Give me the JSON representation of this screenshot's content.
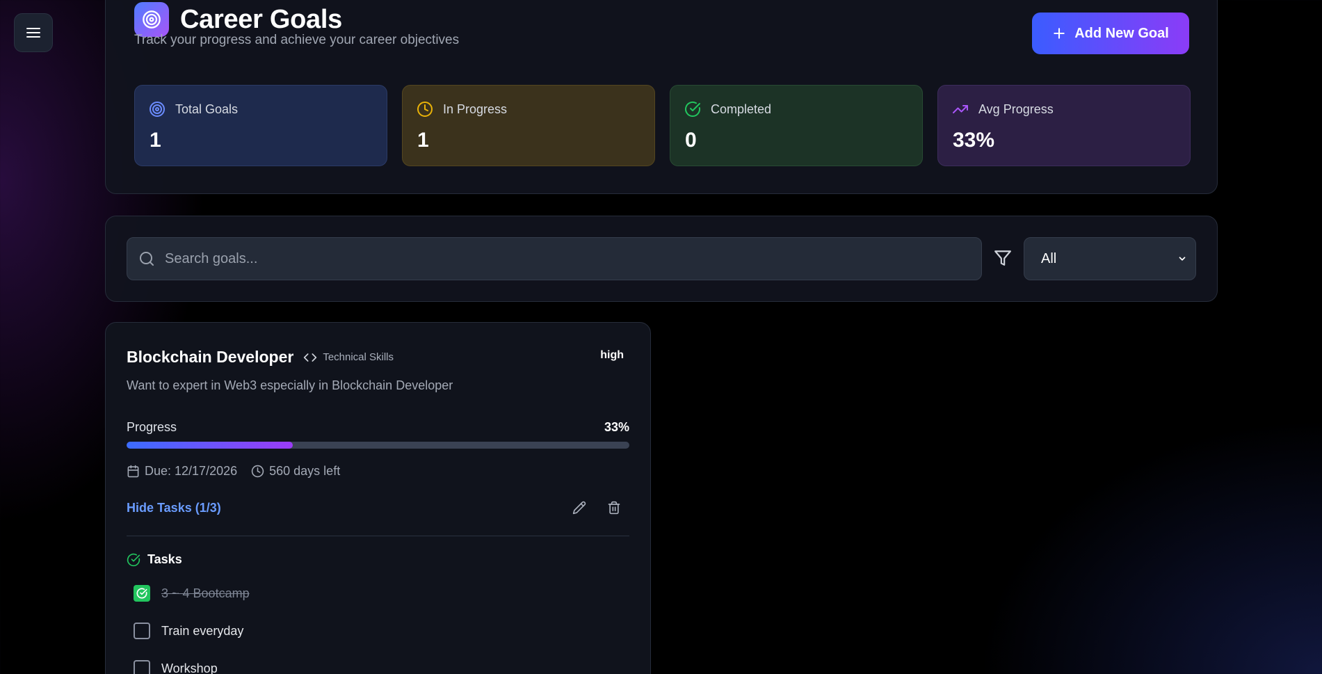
{
  "header": {
    "title": "Career Goals",
    "subtitle": "Track your progress and achieve your career objectives",
    "add_button_label": "Add New Goal"
  },
  "stats": [
    {
      "label": "Total Goals",
      "value": "1",
      "icon": "target-icon",
      "color": "#6b8cff"
    },
    {
      "label": "In Progress",
      "value": "1",
      "icon": "clock-icon",
      "color": "#eab308"
    },
    {
      "label": "Completed",
      "value": "0",
      "icon": "check-circle-icon",
      "color": "#22c55e"
    },
    {
      "label": "Avg Progress",
      "value": "33%",
      "icon": "trending-up-icon",
      "color": "#a855f7"
    }
  ],
  "filters": {
    "search_placeholder": "Search goals...",
    "search_value": "",
    "status_selected": "All"
  },
  "goal": {
    "title": "Blockchain Developer",
    "category": "Technical Skills",
    "priority": "high",
    "description": "Want to expert in Web3 especially in Blockchain Developer",
    "progress_label": "Progress",
    "progress_text": "33%",
    "progress_fraction": 0.33,
    "due": "Due: 12/17/2026",
    "days_left": "560 days left",
    "toggle_tasks_label": "Hide Tasks (1/3)",
    "tasks_heading": "Tasks",
    "tasks": [
      {
        "label": "3 ~ 4 Bootcamp",
        "done": true
      },
      {
        "label": "Train everyday",
        "done": false
      },
      {
        "label": "Workshop",
        "done": false
      }
    ]
  },
  "colors": {
    "accent_blue": "#3b5cff",
    "accent_purple": "#8b3cf7",
    "link_blue": "#6a9cff",
    "success_green": "#22c55e"
  }
}
